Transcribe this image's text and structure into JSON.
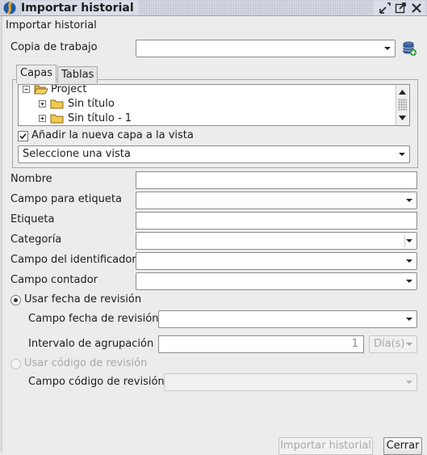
{
  "window": {
    "title": "Importar historial"
  },
  "header": {
    "label": "Importar historial"
  },
  "working_copy": {
    "label": "Copia de trabajo",
    "value": ""
  },
  "tabs": [
    {
      "label": "Capas",
      "active": true
    },
    {
      "label": "Tablas",
      "active": false
    }
  ],
  "tree": {
    "root": "Project",
    "children": [
      "Sin título",
      "Sin título - 1"
    ]
  },
  "add_layer": {
    "label": "Añadir la nueva capa a la vista",
    "checked": true
  },
  "view_select": {
    "value": "Seleccione una vista"
  },
  "form": {
    "name_label": "Nombre",
    "name_value": "",
    "label_field_label": "Campo para etiqueta",
    "label_field_value": "",
    "tag_label": "Etiqueta",
    "tag_value": "",
    "category_label": "Categoría",
    "category_value": "",
    "id_field_label": "Campo del identificador",
    "id_field_value": "",
    "counter_field_label": "Campo contador",
    "counter_field_value": ""
  },
  "revision_date": {
    "label": "Usar fecha de revisión",
    "selected": true,
    "field_label": "Campo fecha de revisión",
    "field_value": "",
    "interval_label": "Intervalo de agrupación",
    "interval_value": "1",
    "unit_value": "Día(s)"
  },
  "revision_code": {
    "label": "Usar código de revisión",
    "selected": false,
    "field_label": "Campo código de revisión",
    "field_value": ""
  },
  "buttons": {
    "import_label": "Importar historial",
    "close_label": "Cerrar"
  },
  "colors": {
    "titlebar": "#d9dde8",
    "background": "#ececec",
    "folder": "#f2c94c",
    "db_icon": "#3d5f9e",
    "db_plus": "#2e9e3a"
  }
}
